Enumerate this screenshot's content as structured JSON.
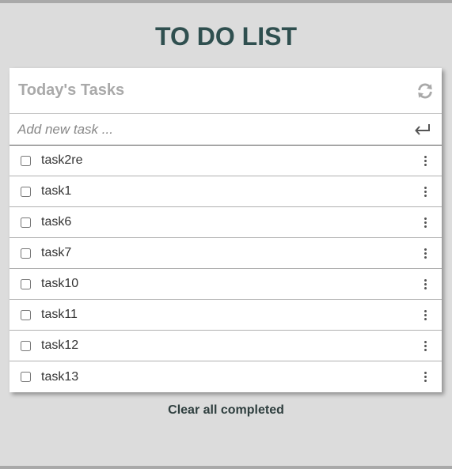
{
  "app": {
    "title": "TO DO LIST"
  },
  "card": {
    "header_title": "Today's Tasks",
    "refresh_icon": "refresh-icon"
  },
  "add_task": {
    "placeholder": "Add new task ...",
    "value": "",
    "submit_icon": "enter-icon"
  },
  "tasks": [
    {
      "label": "task2re",
      "completed": false
    },
    {
      "label": "task1",
      "completed": false
    },
    {
      "label": "task6",
      "completed": false
    },
    {
      "label": "task7",
      "completed": false
    },
    {
      "label": "task10",
      "completed": false
    },
    {
      "label": "task11",
      "completed": false
    },
    {
      "label": "task12",
      "completed": false
    },
    {
      "label": "task13",
      "completed": false
    }
  ],
  "footer": {
    "clear_label": "Clear all completed"
  },
  "colors": {
    "background": "#dcdcdc",
    "title": "#2f4f4f",
    "header_text": "#a9a9a9",
    "card": "#ffffff"
  }
}
